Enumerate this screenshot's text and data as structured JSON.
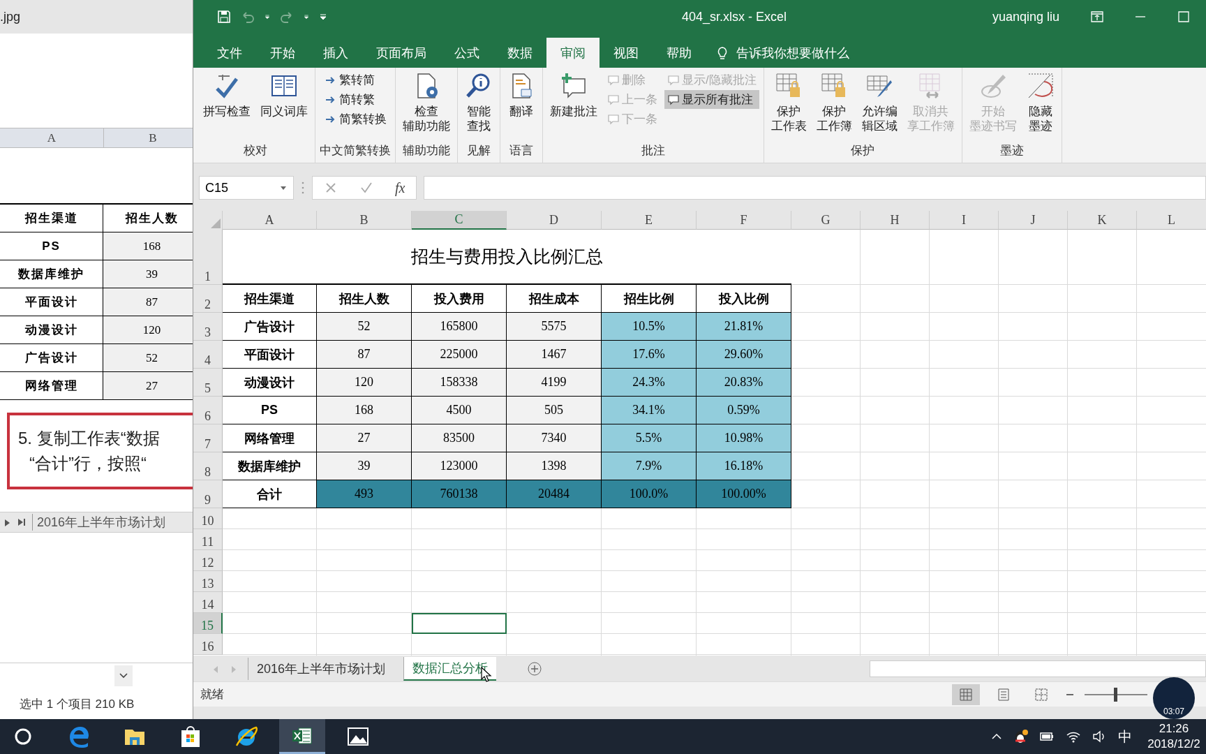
{
  "background_window": {
    "title": ".jpg",
    "columns": [
      "A",
      "B"
    ],
    "table": {
      "header": [
        "招生渠道",
        "招生人数"
      ],
      "rows": [
        [
          "PS",
          "168"
        ],
        [
          "数据库维护",
          "39"
        ],
        [
          "平面设计",
          "87"
        ],
        [
          "动漫设计",
          "120"
        ],
        [
          "广告设计",
          "52"
        ],
        [
          "网络管理",
          "27"
        ]
      ]
    },
    "instruction": [
      "5. 复制工作表“数据",
      "“合计”行，按照“"
    ],
    "sheet_tab": "2016年上半年市场计划",
    "status": "选中 1 个项目  210 KB"
  },
  "excel": {
    "title": "404_sr.xlsx  -  Excel",
    "user": "yuanqing liu",
    "tabs": [
      {
        "label": "文件",
        "selected": false
      },
      {
        "label": "开始",
        "selected": false
      },
      {
        "label": "插入",
        "selected": false
      },
      {
        "label": "页面布局",
        "selected": false
      },
      {
        "label": "公式",
        "selected": false
      },
      {
        "label": "数据",
        "selected": false
      },
      {
        "label": "审阅",
        "selected": true
      },
      {
        "label": "视图",
        "selected": false
      },
      {
        "label": "帮助",
        "selected": false
      }
    ],
    "tell_me": "告诉我你想要做什么",
    "ribbon": [
      {
        "label": "校对",
        "items": [
          {
            "kind": "large",
            "lines": [
              "拼写检查"
            ],
            "disabled": false
          },
          {
            "kind": "large",
            "lines": [
              "同义词库"
            ],
            "disabled": false
          }
        ]
      },
      {
        "label": "中文简繁转换",
        "items": [
          {
            "kind": "small",
            "label": "繁转简",
            "disabled": false,
            "selected": false
          },
          {
            "kind": "small",
            "label": "简转繁",
            "disabled": false,
            "selected": false
          },
          {
            "kind": "small",
            "label": "简繁转换",
            "disabled": false,
            "selected": false
          }
        ]
      },
      {
        "label": "辅助功能",
        "items": [
          {
            "kind": "large",
            "lines": [
              "检查",
              "辅助功能"
            ],
            "disabled": false
          }
        ]
      },
      {
        "label": "见解",
        "items": [
          {
            "kind": "large",
            "lines": [
              "智能",
              "查找"
            ],
            "disabled": false
          }
        ]
      },
      {
        "label": "语言",
        "items": [
          {
            "kind": "large",
            "lines": [
              "翻译"
            ],
            "disabled": false
          }
        ]
      },
      {
        "label": "批注",
        "items": [
          {
            "kind": "large",
            "lines": [
              "新建批注"
            ],
            "disabled": false
          },
          {
            "kind": "small",
            "label": "删除",
            "disabled": true,
            "selected": false
          },
          {
            "kind": "small",
            "label": "上一条",
            "disabled": true,
            "selected": false
          },
          {
            "kind": "small",
            "label": "下一条",
            "disabled": true,
            "selected": false
          },
          {
            "kind": "small",
            "label": "显示/隐藏批注",
            "disabled": true,
            "selected": false
          },
          {
            "kind": "small",
            "label": "显示所有批注",
            "disabled": false,
            "selected": true
          }
        ]
      },
      {
        "label": "保护",
        "items": [
          {
            "kind": "large",
            "lines": [
              "保护",
              "工作表"
            ],
            "disabled": false
          },
          {
            "kind": "large",
            "lines": [
              "保护",
              "工作簿"
            ],
            "disabled": false
          },
          {
            "kind": "large",
            "lines": [
              "允许编",
              "辑区域"
            ],
            "disabled": false
          },
          {
            "kind": "large",
            "lines": [
              "取消共",
              "享工作簿"
            ],
            "disabled": true
          }
        ]
      },
      {
        "label": "墨迹",
        "items": [
          {
            "kind": "large",
            "lines": [
              "开始",
              "墨迹书写"
            ],
            "disabled": true
          },
          {
            "kind": "large",
            "lines": [
              "隐藏",
              "墨迹"
            ],
            "disabled": false
          }
        ]
      }
    ],
    "name_box": "C15",
    "formula_button": "fx",
    "columns": [
      {
        "label": "A",
        "selected": false
      },
      {
        "label": "B",
        "selected": false
      },
      {
        "label": "C",
        "selected": true
      },
      {
        "label": "D",
        "selected": false
      },
      {
        "label": "E",
        "selected": false
      },
      {
        "label": "F",
        "selected": false
      },
      {
        "label": "G",
        "selected": false
      },
      {
        "label": "H",
        "selected": false
      },
      {
        "label": "I",
        "selected": false
      },
      {
        "label": "J",
        "selected": false
      },
      {
        "label": "K",
        "selected": false
      },
      {
        "label": "L",
        "selected": false
      }
    ],
    "rows": [
      {
        "label": "1",
        "selected": false
      },
      {
        "label": "2",
        "selected": false
      },
      {
        "label": "3",
        "selected": false
      },
      {
        "label": "4",
        "selected": false
      },
      {
        "label": "5",
        "selected": false
      },
      {
        "label": "6",
        "selected": false
      },
      {
        "label": "7",
        "selected": false
      },
      {
        "label": "8",
        "selected": false
      },
      {
        "label": "9",
        "selected": false
      },
      {
        "label": "10",
        "selected": false
      },
      {
        "label": "11",
        "selected": false
      },
      {
        "label": "12",
        "selected": false
      },
      {
        "label": "13",
        "selected": false
      },
      {
        "label": "14",
        "selected": false
      },
      {
        "label": "15",
        "selected": true
      },
      {
        "label": "16",
        "selected": false
      }
    ],
    "sheet_title": "招生与费用投入比例汇总",
    "table": {
      "columns": [
        {
          "label": "招生渠道",
          "kind": "label"
        },
        {
          "label": "招生人数",
          "kind": "number"
        },
        {
          "label": "投入费用",
          "kind": "number"
        },
        {
          "label": "招生成本",
          "kind": "number"
        },
        {
          "label": "招生比例",
          "kind": "ratio"
        },
        {
          "label": "投入比例",
          "kind": "ratio"
        }
      ],
      "rows": [
        {
          "kind": "data",
          "cells": [
            "广告设计",
            "52",
            "165800",
            "5575",
            "10.5%",
            "21.81%"
          ]
        },
        {
          "kind": "data",
          "cells": [
            "平面设计",
            "87",
            "225000",
            "1467",
            "17.6%",
            "29.60%"
          ]
        },
        {
          "kind": "data",
          "cells": [
            "动漫设计",
            "120",
            "158338",
            "4199",
            "24.3%",
            "20.83%"
          ]
        },
        {
          "kind": "data",
          "cells": [
            "PS",
            "168",
            "4500",
            "505",
            "34.1%",
            "0.59%"
          ]
        },
        {
          "kind": "data",
          "cells": [
            "网络管理",
            "27",
            "83500",
            "7340",
            "5.5%",
            "10.98%"
          ]
        },
        {
          "kind": "data",
          "cells": [
            "数据库维护",
            "39",
            "123000",
            "1398",
            "7.9%",
            "16.18%"
          ]
        },
        {
          "kind": "total",
          "cells": [
            "合计",
            "493",
            "760138",
            "20484",
            "100.0%",
            "100.00%"
          ]
        }
      ]
    },
    "sheet_tabs": [
      {
        "label": "2016年上半年市场计划",
        "selected": false
      },
      {
        "label": "数据汇总分析",
        "selected": true
      }
    ],
    "status": "就绪",
    "views": [
      {
        "kind": "normal",
        "selected": true
      },
      {
        "kind": "page-layout",
        "selected": false
      },
      {
        "kind": "page-break",
        "selected": false
      }
    ],
    "zoom": {
      "level": 0.5
    }
  },
  "recorder_badge": "03:07",
  "taskbar": {
    "apps": [
      {
        "kind": "search",
        "selected": false
      },
      {
        "kind": "edge",
        "selected": false
      },
      {
        "kind": "explorer",
        "selected": false
      },
      {
        "kind": "store",
        "selected": false
      },
      {
        "kind": "ie",
        "selected": false
      },
      {
        "kind": "excel",
        "selected": true
      },
      {
        "kind": "photos",
        "selected": false
      }
    ],
    "ime": "中",
    "time": "21:26",
    "date": "2018/12/2"
  }
}
